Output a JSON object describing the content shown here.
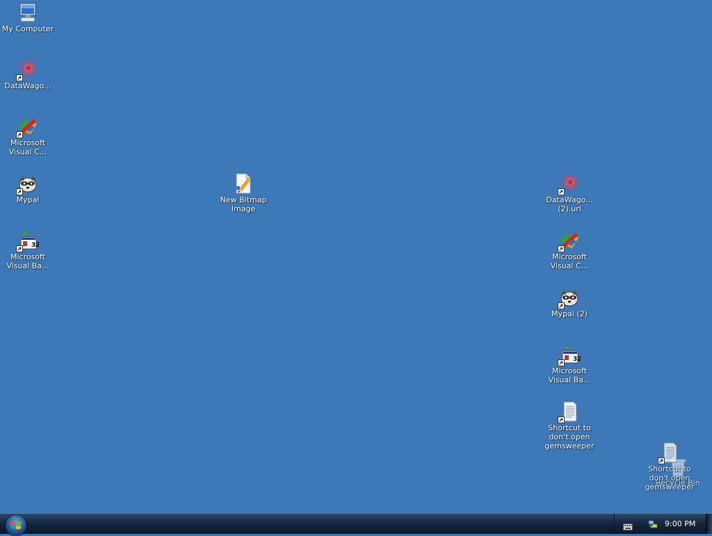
{
  "desktop": {
    "icons": [
      {
        "label": "My Computer",
        "icon": "computer-icon"
      },
      {
        "label": "DataWago...",
        "icon": "datawagon-icon"
      },
      {
        "label": "Microsoft\nVisual C...",
        "icon": "visual-c-icon"
      },
      {
        "label": "Mypal",
        "icon": "raccoon-icon"
      },
      {
        "label": "Microsoft\nVisual Ba...",
        "icon": "visual-basic-icon"
      },
      {
        "label": "New Bitmap\nImage",
        "icon": "bitmap-icon"
      },
      {
        "label": "DataWago...\n(2).url",
        "icon": "datawagon-icon"
      },
      {
        "label": "Microsoft\nVisual C...",
        "icon": "visual-c-icon"
      },
      {
        "label": "Mypal (2)",
        "icon": "raccoon-icon"
      },
      {
        "label": "Microsoft\nVisual Ba...",
        "icon": "visual-basic-icon"
      },
      {
        "label": "Shortcut to\ndon't open\ngemsweeper",
        "icon": "text-document-icon"
      },
      {
        "label": "Shortcut to\ndon't open\ngemsweeper",
        "icon": "text-document-icon"
      },
      {
        "label": "Recycle Bin",
        "icon": "recycle-bin-icon"
      }
    ]
  },
  "taskbar": {
    "clock": "9:00 PM",
    "tray_icons": [
      "keyboard-icon",
      "network-icon"
    ]
  },
  "colors": {
    "desktop_background": "#3d79b8",
    "taskbar": "#16273c"
  }
}
